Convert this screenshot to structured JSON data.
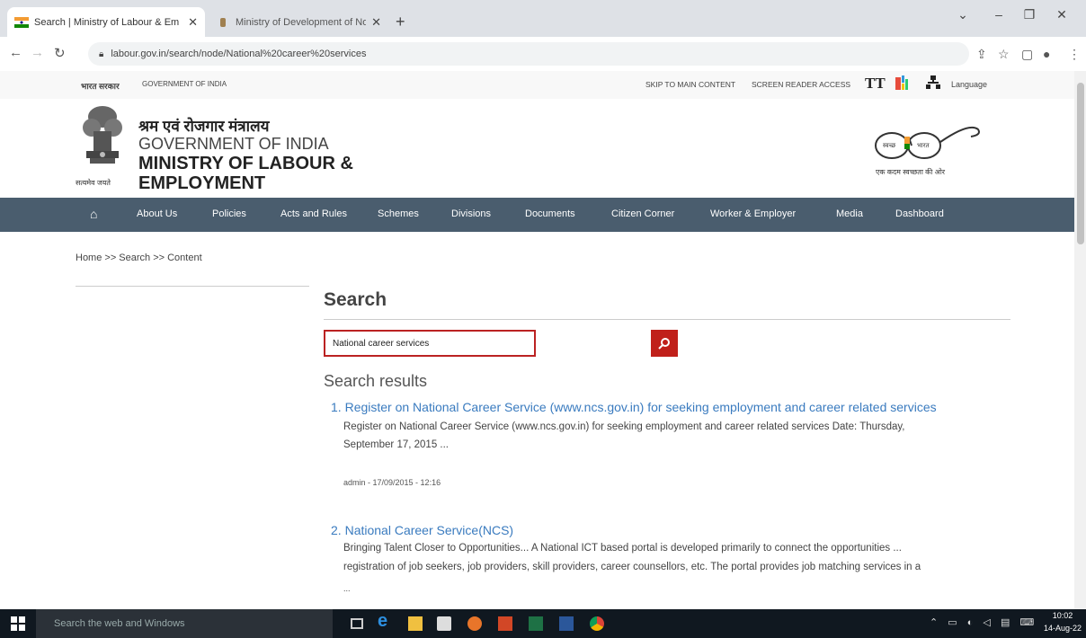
{
  "browser": {
    "tabs": [
      {
        "label": "Search | Ministry of Labour & Em",
        "active": true
      },
      {
        "label": "Ministry of Development of Nor",
        "active": false
      }
    ],
    "new_tab": "+",
    "url": "labour.gov.in/search/node/National%20career%20services",
    "window_controls": [
      "⌄",
      "–",
      "❐",
      "✕"
    ]
  },
  "topbar": {
    "gov_hindi": "भारत सरकार",
    "gov_english": "GOVERNMENT OF INDIA",
    "skip": "SKIP TO MAIN CONTENT",
    "screen_reader": "SCREEN READER ACCESS",
    "text_size": "TT",
    "language": "Language"
  },
  "header": {
    "hindi_title": "श्रम एवं रोजगार मंत्रालय",
    "gov": "GOVERNMENT OF INDIA",
    "ministry_line1": "MINISTRY OF LABOUR &",
    "ministry_line2": "EMPLOYMENT",
    "emblem_motto": "सत्यमेव जयते",
    "swachh_left": "स्वच्छ",
    "swachh_right": "भारत",
    "swachh_caption": "एक कदम स्वच्छता की ओर"
  },
  "nav": {
    "items": [
      "About Us",
      "Policies",
      "Acts and Rules",
      "Schemes",
      "Divisions",
      "Documents",
      "Citizen Corner",
      "Worker & Employer",
      "Media",
      "Dashboard"
    ]
  },
  "breadcrumb": "Home >> Search >> Content",
  "search": {
    "heading": "Search",
    "value": "National career services",
    "results_heading": "Search results"
  },
  "results": [
    {
      "num": "1.",
      "title": "Register on National Career Service (www.ncs.gov.in) for seeking employment and career related services",
      "line1": "Register on National Career Service (www.ncs.gov.in) for seeking employment and career related services Date:  Thursday,",
      "line2": "September 17, 2015 ...",
      "meta": "admin - 17/09/2015 - 12:16"
    },
    {
      "num": "2.",
      "title": "National Career Service(NCS)",
      "line1": "Bringing Talent Closer to Opportunities... A National ICT based portal is developed primarily to connect the opportunities ...",
      "line2": "registration of job seekers, job providers, skill providers, career counsellors, etc. The portal provides job matching services in a",
      "line3": "..."
    }
  ],
  "taskbar": {
    "search_placeholder": "Search the web and Windows",
    "time": "10:02",
    "date": "14-Aug-22"
  },
  "colors": {
    "nav_bg": "#4a5d6e",
    "search_button": "#c0201a",
    "link": "#3a7bbf",
    "taskbar": "#101820"
  }
}
